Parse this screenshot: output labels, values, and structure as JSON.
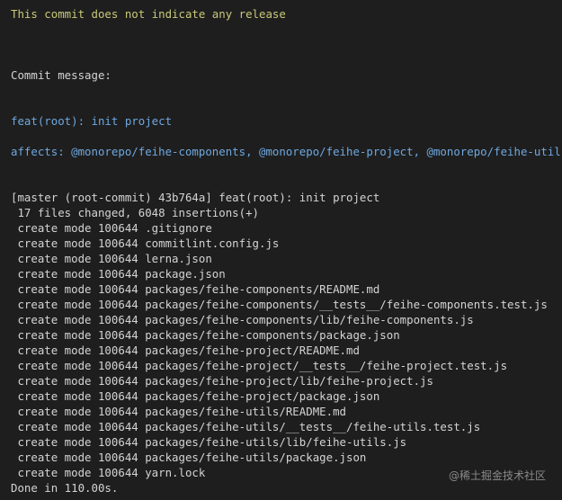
{
  "terminal": {
    "release_notice": "This commit does not indicate any release",
    "commit_message_label": "Commit message:",
    "commit_subject": "feat(root): init project",
    "affects_line": "affects: @monorepo/feihe-components, @monorepo/feihe-project, @monorepo/feihe-utils",
    "commit_header": "[master (root-commit) 43b764a] feat(root): init project",
    "summary": " 17 files changed, 6048 insertions(+)",
    "created_files": [
      " create mode 100644 .gitignore",
      " create mode 100644 commitlint.config.js",
      " create mode 100644 lerna.json",
      " create mode 100644 package.json",
      " create mode 100644 packages/feihe-components/README.md",
      " create mode 100644 packages/feihe-components/__tests__/feihe-components.test.js",
      " create mode 100644 packages/feihe-components/lib/feihe-components.js",
      " create mode 100644 packages/feihe-components/package.json",
      " create mode 100644 packages/feihe-project/README.md",
      " create mode 100644 packages/feihe-project/__tests__/feihe-project.test.js",
      " create mode 100644 packages/feihe-project/lib/feihe-project.js",
      " create mode 100644 packages/feihe-project/package.json",
      " create mode 100644 packages/feihe-utils/README.md",
      " create mode 100644 packages/feihe-utils/__tests__/feihe-utils.test.js",
      " create mode 100644 packages/feihe-utils/lib/feihe-utils.js",
      " create mode 100644 packages/feihe-utils/package.json",
      " create mode 100644 yarn.lock"
    ],
    "done_line": "Done in 110.00s."
  },
  "watermark": "@稀土掘金技术社区",
  "colors": {
    "background": "#1e1e1e",
    "text": "#d4d4d4",
    "notice": "#c9c97a",
    "message": "#6ea8e0"
  }
}
